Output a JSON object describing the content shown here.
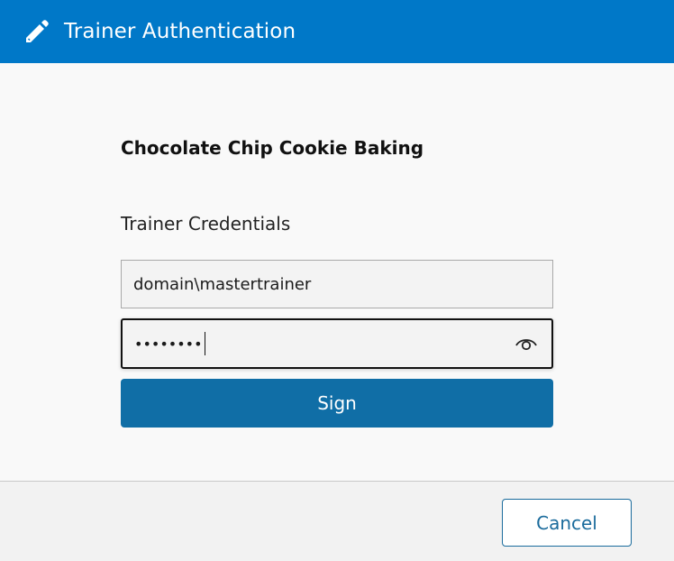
{
  "header": {
    "title": "Trainer Authentication",
    "icon": "pencil-icon",
    "background": "#0078c8"
  },
  "main": {
    "course_title": "Chocolate Chip Cookie Baking",
    "credentials_label": "Trainer Credentials",
    "username_value": "domain\\mastertrainer",
    "password_value": "••••••••",
    "eye_icon": "eye-icon",
    "sign_label": "Sign",
    "accent": "#106ea6"
  },
  "footer": {
    "cancel_label": "Cancel"
  }
}
